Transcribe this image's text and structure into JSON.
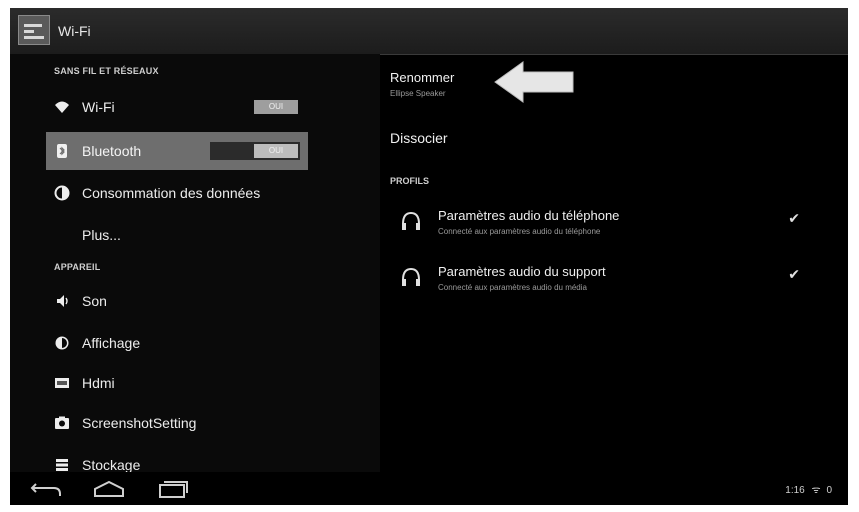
{
  "actionbar": {
    "title": "Wi-Fi",
    "icon": "settings-app-icon"
  },
  "left_pane": {
    "section_wireless": "SANS FIL ET RÉSEAUX",
    "wifi": {
      "label": "Wi-Fi",
      "toggle": "OUI",
      "icon": "wifi-icon"
    },
    "bluetooth": {
      "label": "Bluetooth",
      "toggle": "OUI",
      "icon": "bluetooth-icon"
    },
    "data_usage": {
      "label": "Consommation des données",
      "icon": "data-usage-icon"
    },
    "more": {
      "label": "Plus..."
    },
    "section_device": "APPAREIL",
    "sound": {
      "label": "Son",
      "icon": "sound-icon"
    },
    "display": {
      "label": "Affichage",
      "icon": "display-icon"
    },
    "hdmi": {
      "label": "Hdmi",
      "icon": "hdmi-icon"
    },
    "screenshot": {
      "label": "ScreenshotSetting",
      "icon": "screenshot-icon"
    },
    "storage": {
      "label": "Stockage",
      "icon": "storage-icon"
    }
  },
  "right_pane": {
    "rename": {
      "title": "Renommer",
      "subtitle": "Ellipse Speaker"
    },
    "dissocier": "Dissocier",
    "profiles_header": "PROFILS",
    "profiles": [
      {
        "title": "Paramètres audio du téléphone",
        "subtitle": "Connecté aux paramètres audio du téléphone",
        "checked": "✔"
      },
      {
        "title": "Paramètres audio du support",
        "subtitle": "Connecté aux paramètres audio du média",
        "checked": "✔"
      }
    ]
  },
  "navbar": {
    "time": "1:16",
    "wifi_symbol": "ᯤ",
    "battery_text": "0"
  },
  "colors": {
    "background": "#000000",
    "selected_row": "#dadada",
    "text": "#f0f0f0",
    "subtext": "#9a9a9a"
  }
}
